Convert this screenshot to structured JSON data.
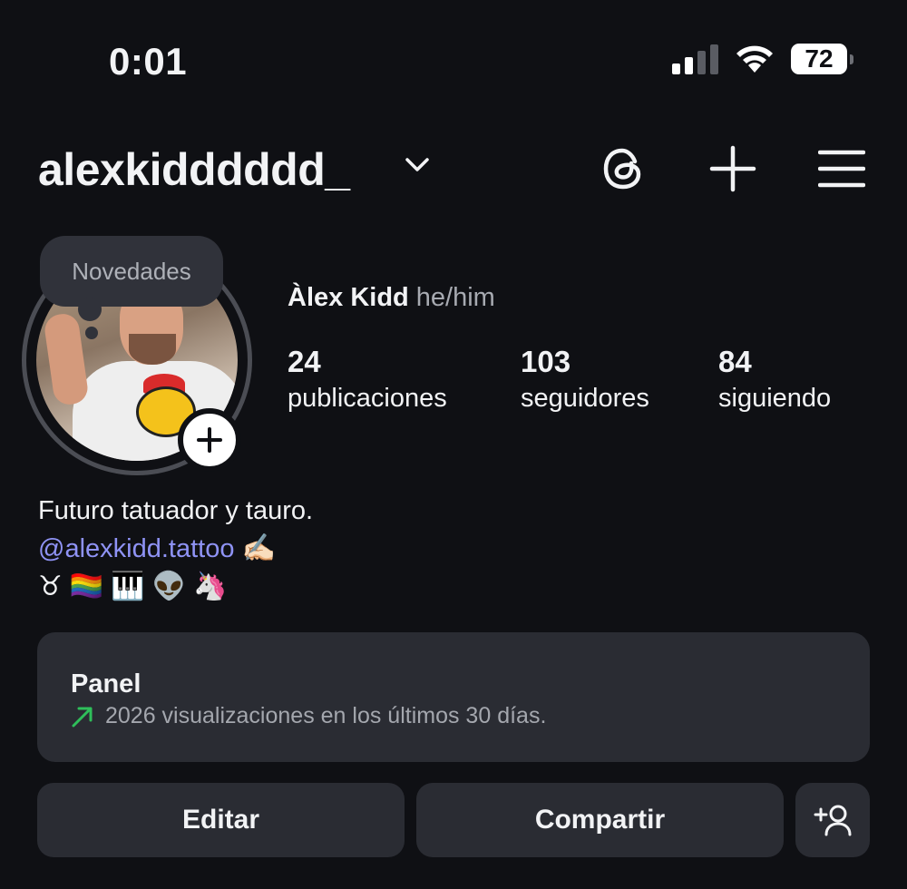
{
  "status_bar": {
    "time": "0:01",
    "battery": "72",
    "signal_bars_active": 2,
    "signal_bars_total": 4
  },
  "header": {
    "username": "alexkidddddd_",
    "icons": [
      "chevron-down-icon",
      "threads-icon",
      "plus-icon",
      "menu-icon"
    ]
  },
  "notes_bubble": {
    "label": "Novedades"
  },
  "profile": {
    "name": "Àlex Kidd",
    "pronouns": "he/him",
    "stats": [
      {
        "value": "24",
        "label": "publicaciones"
      },
      {
        "value": "103",
        "label": "seguidores"
      },
      {
        "value": "84",
        "label": "siguiendo"
      }
    ]
  },
  "bio": {
    "line1": "Futuro tatuador y tauro.",
    "link": "@alexkidd.tattoo",
    "link_emoji": "✍🏻",
    "emojis": [
      "♉",
      "🏳️‍🌈",
      "🎹",
      "👽",
      "🦄"
    ]
  },
  "panel": {
    "title": "Panel",
    "subtitle": "2026 visualizaciones en los últimos 30 días."
  },
  "buttons": {
    "edit": "Editar",
    "share": "Compartir"
  },
  "colors": {
    "background": "#0f1014",
    "card": "#2a2c33",
    "link": "#8f93f5",
    "trend_up": "#2fbf5a"
  }
}
